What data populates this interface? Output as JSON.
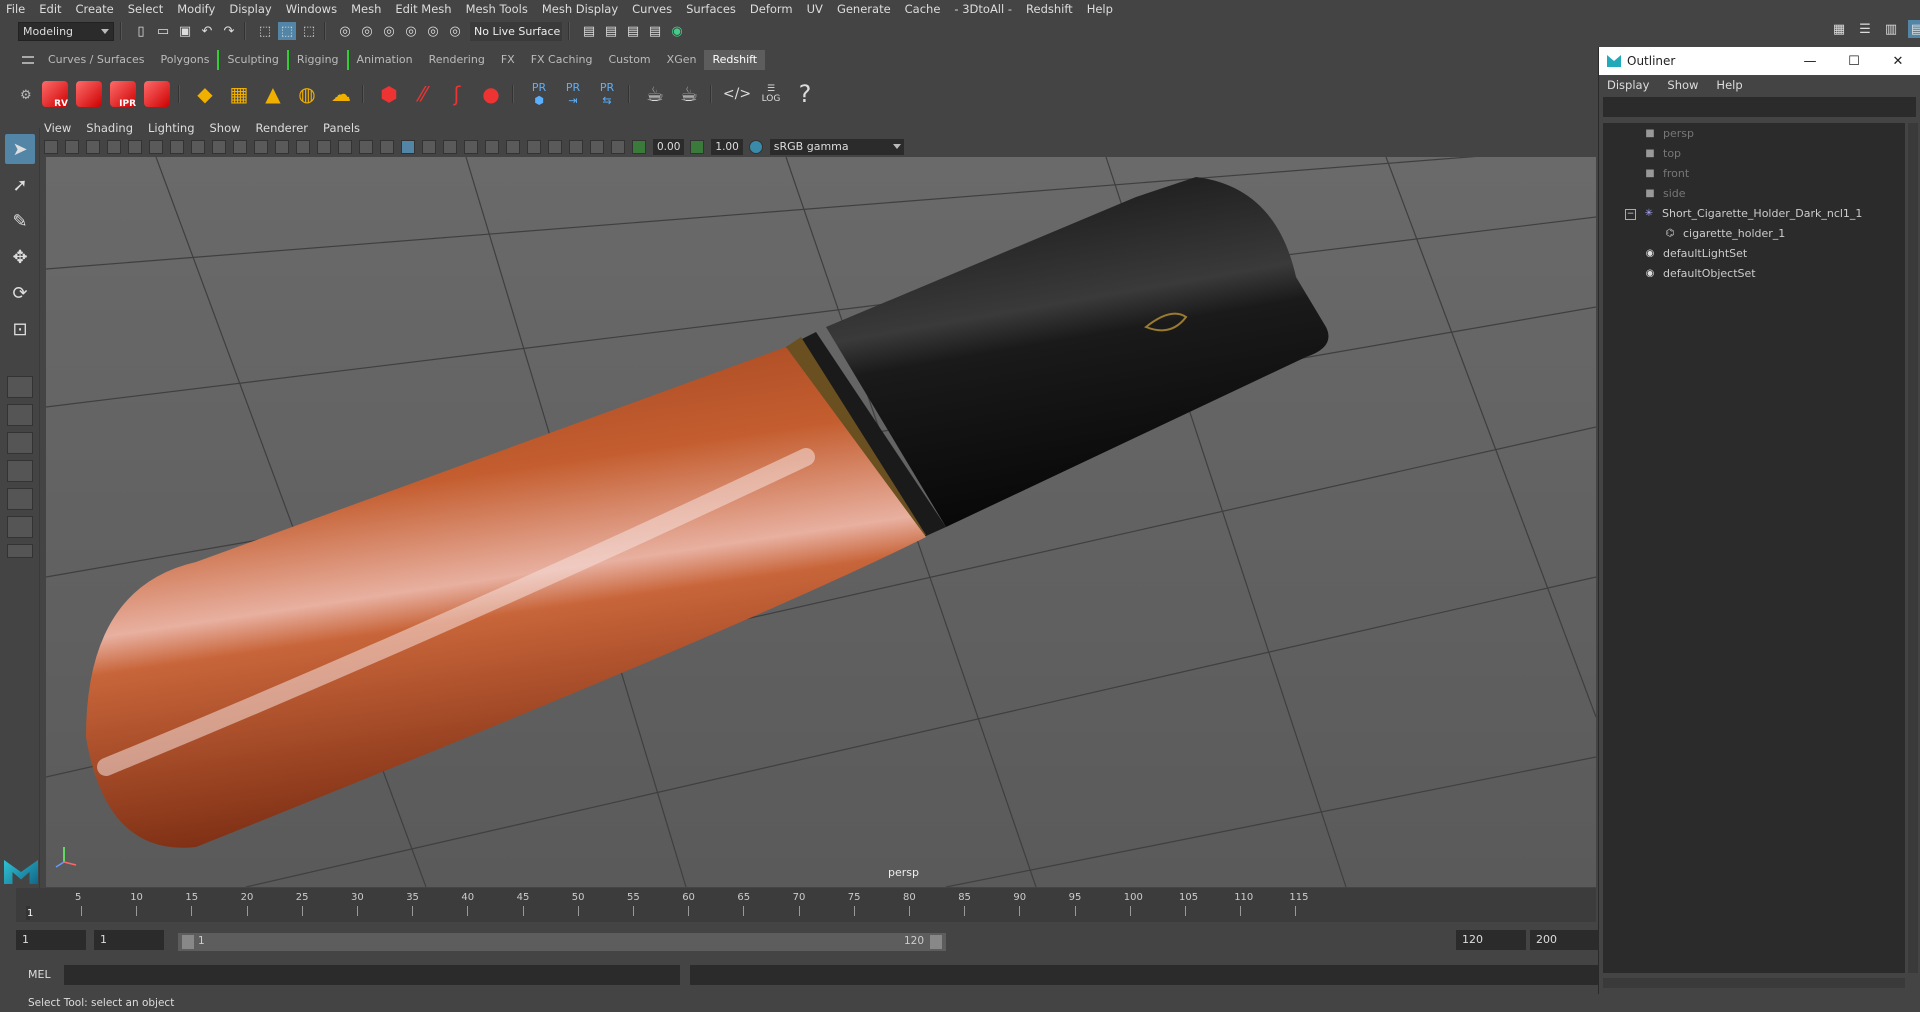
{
  "menubar": [
    "File",
    "Edit",
    "Create",
    "Select",
    "Modify",
    "Display",
    "Windows",
    "Mesh",
    "Edit Mesh",
    "Mesh Tools",
    "Mesh Display",
    "Curves",
    "Surfaces",
    "Deform",
    "UV",
    "Generate",
    "Cache",
    "- 3DtoAll -",
    "Redshift",
    "Help"
  ],
  "statusline": {
    "mode": "Modeling",
    "live_surface": "No Live Surface"
  },
  "shelf_tabs": [
    "Curves / Surfaces",
    "Polygons",
    "Sculpting",
    "Rigging",
    "Animation",
    "Rendering",
    "FX",
    "FX Caching",
    "Custom",
    "XGen",
    "Redshift"
  ],
  "shelf_active": "Redshift",
  "shelf_labels": {
    "rv": "RV",
    "ipr": "IPR",
    "pr": "PR",
    "log": "LOG"
  },
  "viewport_menu": [
    "View",
    "Shading",
    "Lighting",
    "Show",
    "Renderer",
    "Panels"
  ],
  "viewport_toolbar": {
    "exposure": "0.00",
    "gamma_value": "1.00",
    "color_space": "sRGB gamma"
  },
  "viewport": {
    "camera_label": "persp"
  },
  "timeline": {
    "ticks": [
      "5",
      "10",
      "15",
      "20",
      "25",
      "30",
      "35",
      "40",
      "45",
      "50",
      "55",
      "60",
      "65",
      "70",
      "75",
      "80",
      "85",
      "90",
      "95",
      "100",
      "105",
      "110",
      "115"
    ],
    "current_frame": "1"
  },
  "range": {
    "start": "1",
    "playback_start": "1",
    "slider_start": "1",
    "slider_end": "120",
    "playback_end": "120",
    "end": "200"
  },
  "cmdline": {
    "label": "MEL"
  },
  "helpline": "Select Tool: select an object",
  "outliner": {
    "title": "Outliner",
    "menu": [
      "Display",
      "Show",
      "Help"
    ],
    "items": [
      {
        "label": "persp",
        "dim": true
      },
      {
        "label": "top",
        "dim": true
      },
      {
        "label": "front",
        "dim": true
      },
      {
        "label": "side",
        "dim": true
      },
      {
        "label": "Short_Cigarette_Holder_Dark_ncl1_1",
        "dim": false
      },
      {
        "label": "cigarette_holder_1",
        "dim": false
      },
      {
        "label": "defaultLightSet",
        "dim": false
      },
      {
        "label": "defaultObjectSet",
        "dim": false
      }
    ]
  }
}
